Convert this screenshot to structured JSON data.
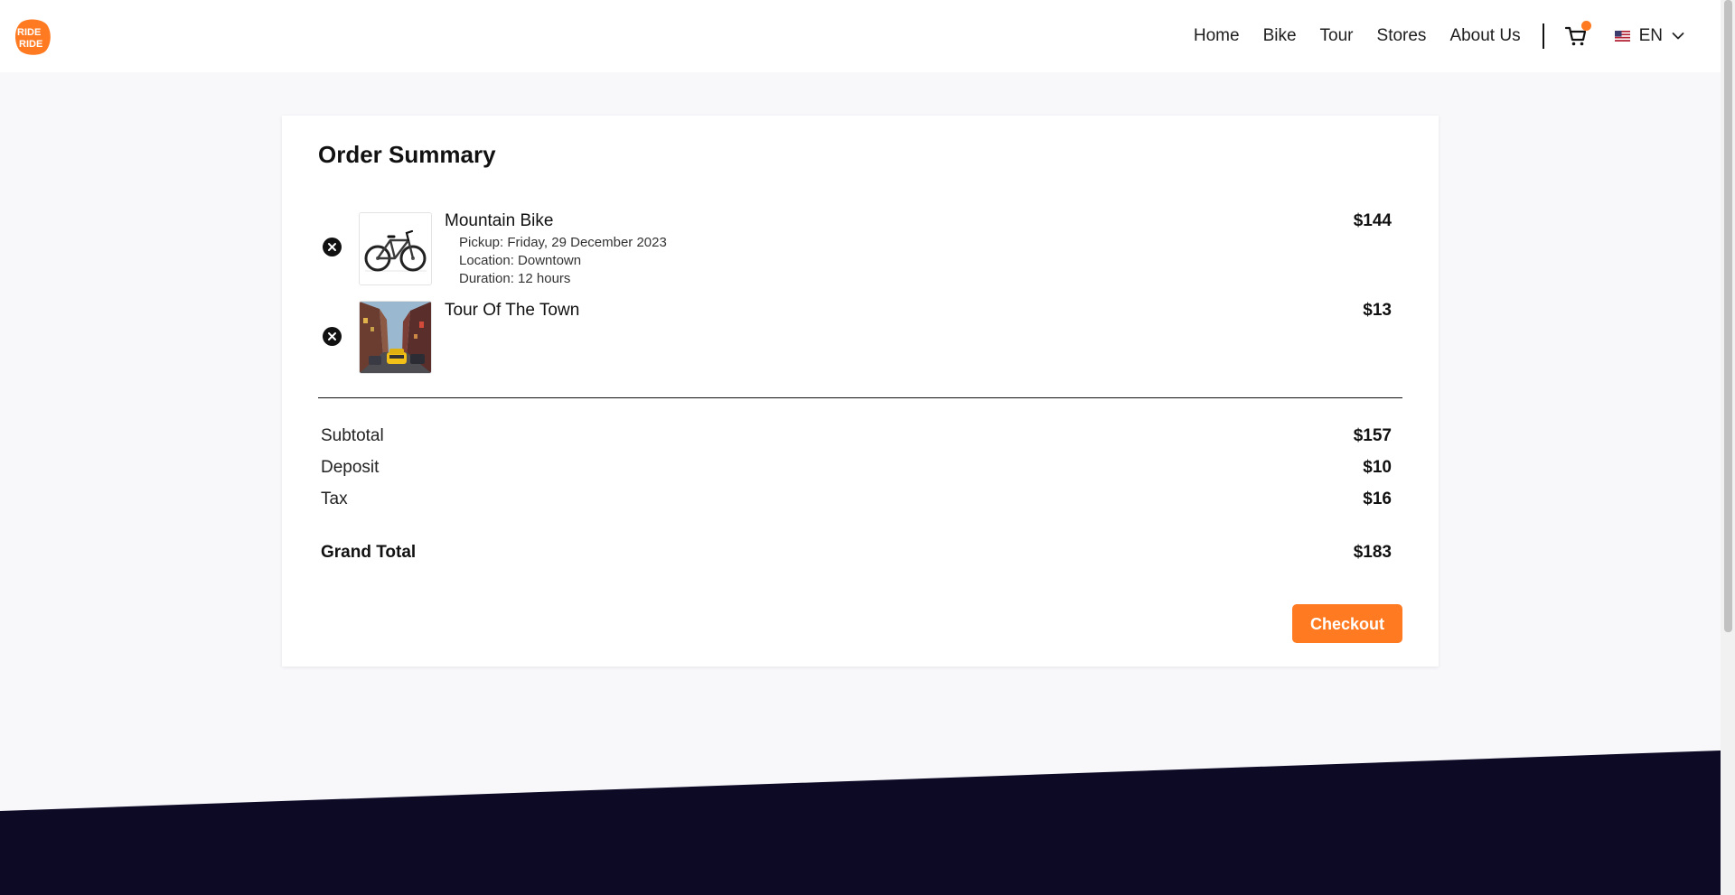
{
  "header": {
    "logo_text_top": "RIDE",
    "logo_text_bottom": "RIDE",
    "nav": [
      "Home",
      "Bike",
      "Tour",
      "Stores",
      "About Us"
    ],
    "cart_has_items": true,
    "language": "EN"
  },
  "order": {
    "title": "Order Summary",
    "items": [
      {
        "name": "Mountain Bike",
        "price": "$144",
        "details": [
          "Pickup: Friday, 29 December 2023",
          "Location: Downtown",
          "Duration: 12 hours"
        ],
        "image": "mountain-bike-photo"
      },
      {
        "name": "Tour Of The Town",
        "price": "$13",
        "details": [],
        "image": "city-street-photo"
      }
    ],
    "summary": {
      "subtotal_label": "Subtotal",
      "subtotal": "$157",
      "deposit_label": "Deposit",
      "deposit": "$10",
      "tax_label": "Tax",
      "tax": "$16",
      "grand_total_label": "Grand Total",
      "grand_total": "$183"
    },
    "checkout_label": "Checkout"
  },
  "colors": {
    "accent": "#ff7a21",
    "footer": "#0d0a26",
    "page_bg": "#f8f8fb"
  }
}
